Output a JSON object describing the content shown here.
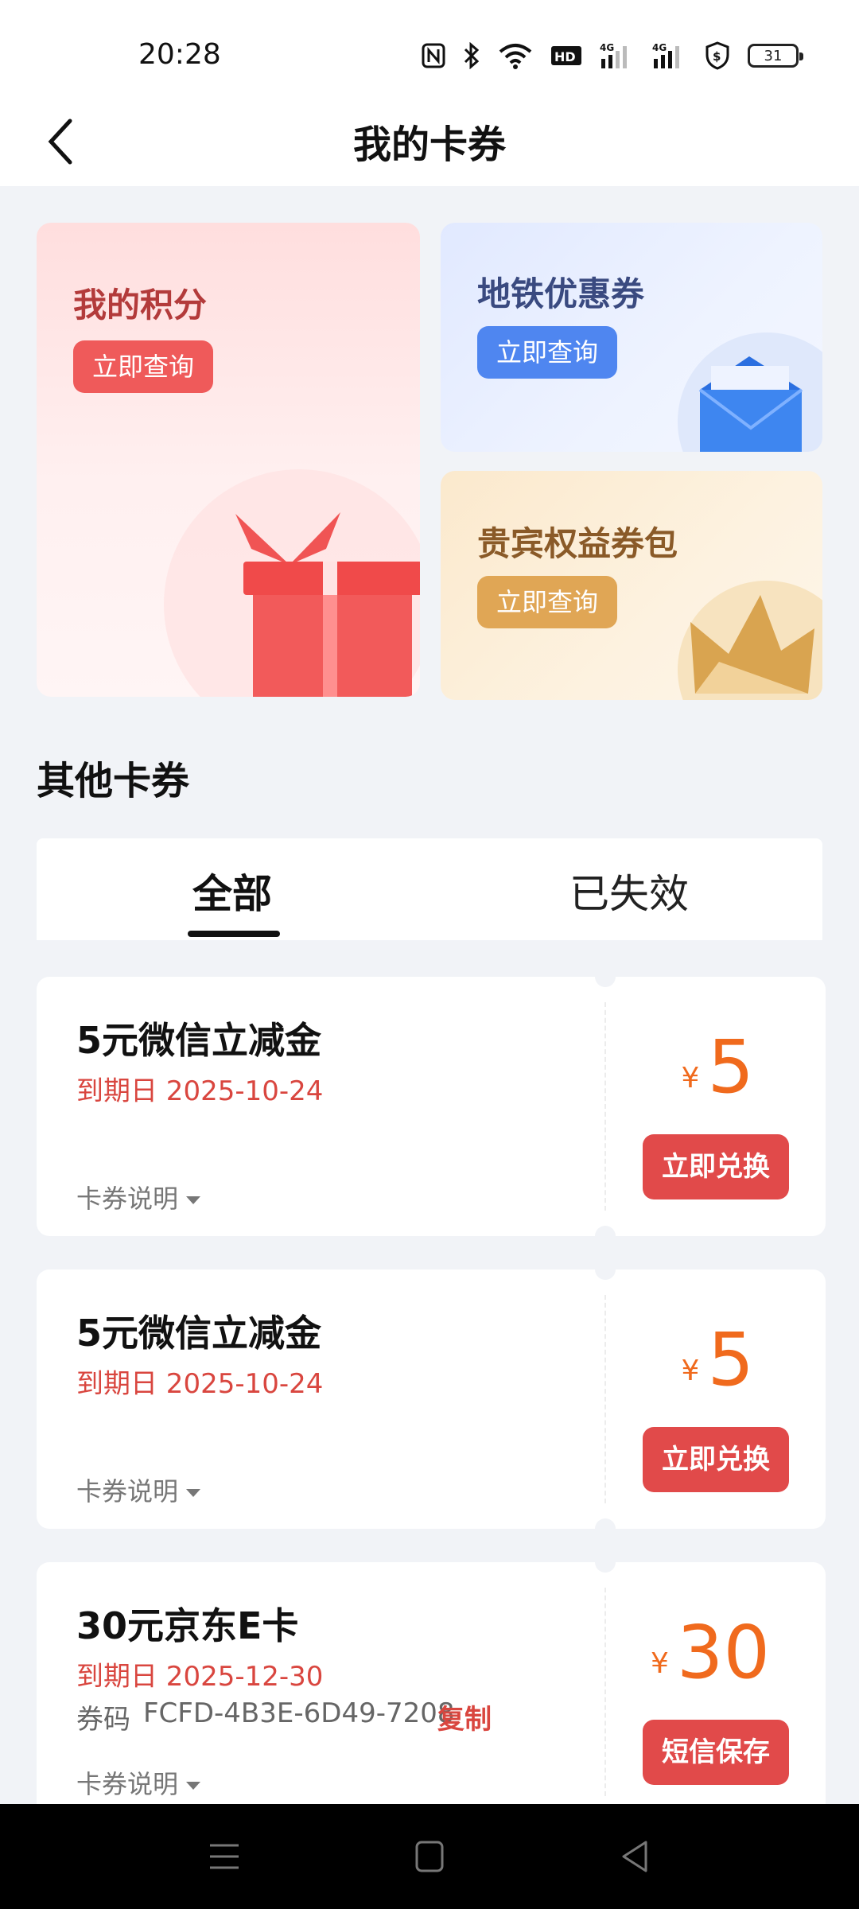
{
  "status": {
    "time": "20:28",
    "battery": "31"
  },
  "header": {
    "title": "我的卡券"
  },
  "promos": {
    "points": {
      "title": "我的积分",
      "button": "立即查询"
    },
    "metro": {
      "title": "地铁优惠券",
      "button": "立即查询"
    },
    "vip": {
      "title": "贵宾权益券包",
      "button": "立即查询"
    }
  },
  "section": {
    "title": "其他卡券"
  },
  "tabs": [
    {
      "label": "全部",
      "active": true
    },
    {
      "label": "已失效",
      "active": false
    }
  ],
  "coupons": [
    {
      "name": "5元微信立减金",
      "expiry": "到期日 2025-10-24",
      "currency": "¥",
      "amount": "5",
      "desc": "卡券说明",
      "action": "立即兑换"
    },
    {
      "name": "5元微信立减金",
      "expiry": "到期日 2025-10-24",
      "currency": "¥",
      "amount": "5",
      "desc": "卡券说明",
      "action": "立即兑换"
    },
    {
      "name": "30元京东E卡",
      "expiry": "到期日 2025-12-30",
      "code_label": "券码",
      "code": "FCFD-4B3E-6D49-7208",
      "copy": "复制",
      "currency": "¥",
      "amount": "30",
      "desc": "卡券说明",
      "action": "短信保存"
    }
  ],
  "colors": {
    "accent_red": "#e14a4a",
    "price_orange": "#f06a1d",
    "metro_blue": "#4f86f0",
    "vip_gold": "#e0a655"
  }
}
